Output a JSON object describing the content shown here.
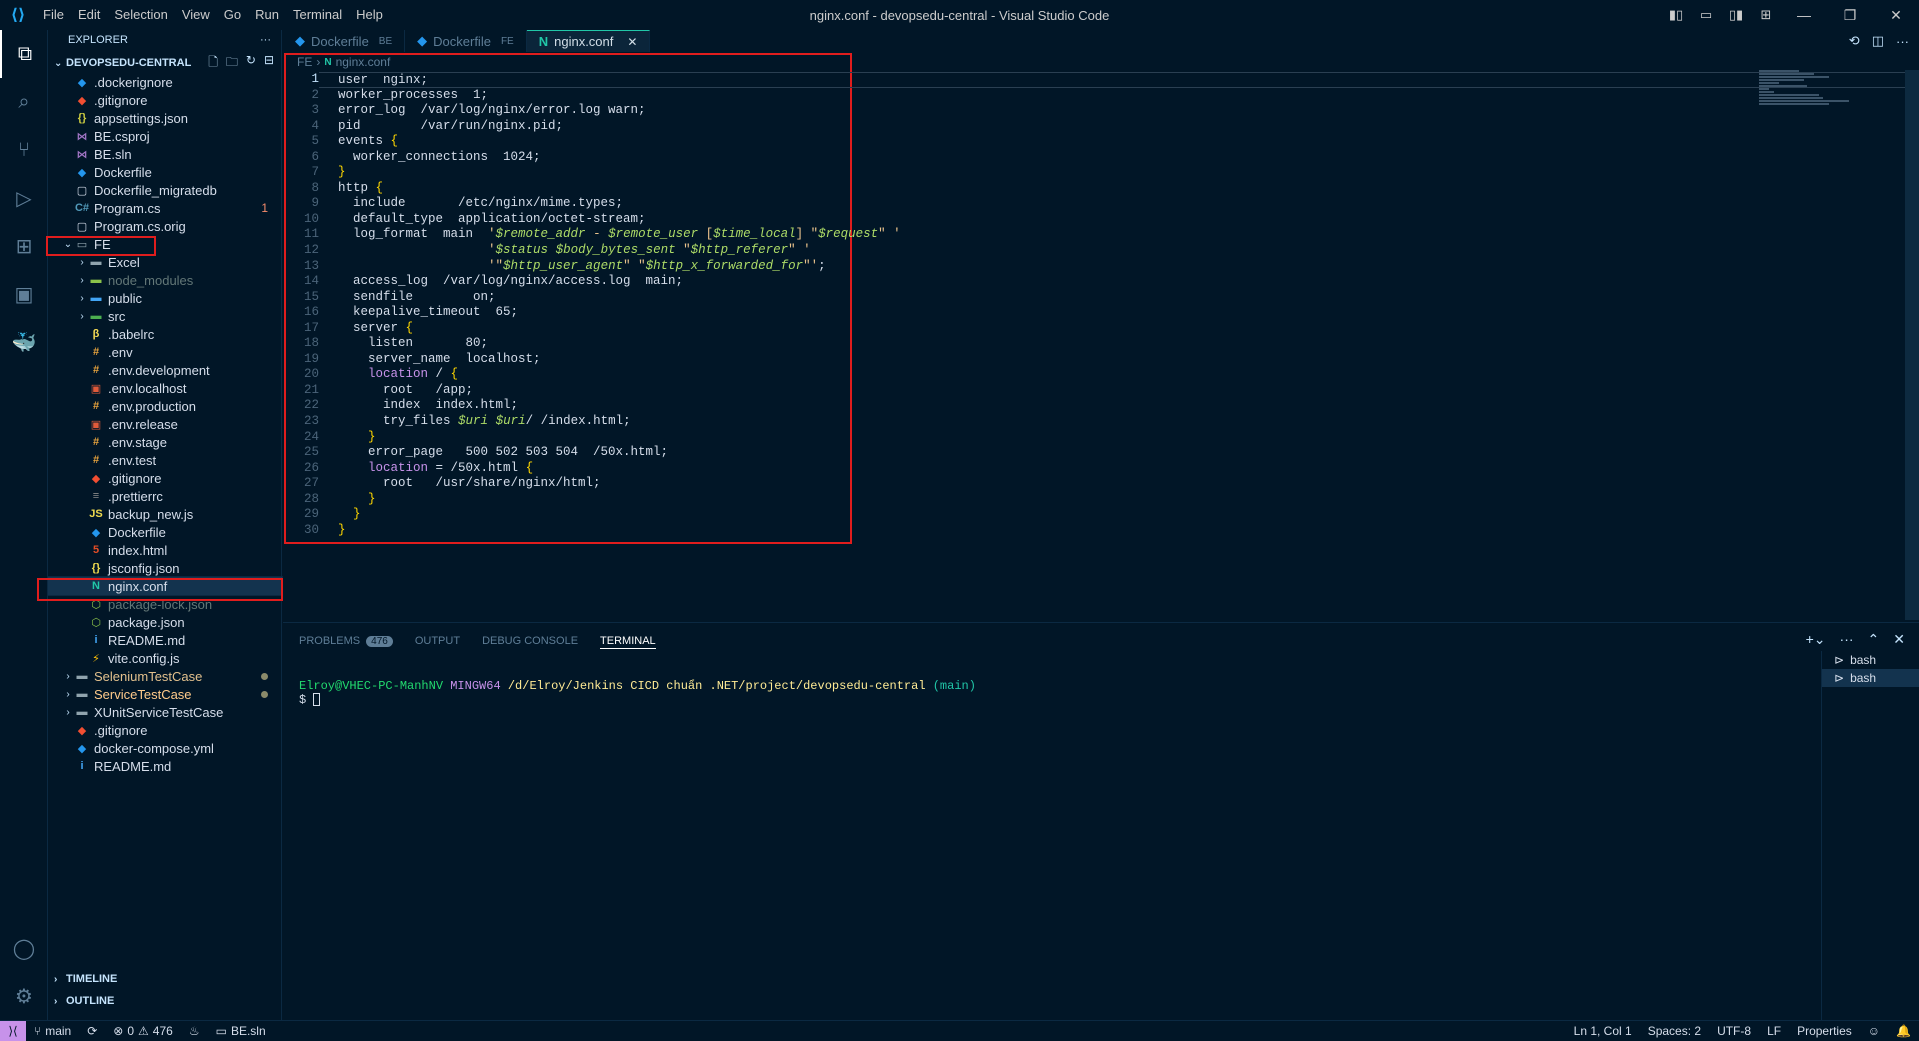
{
  "titlebar": {
    "menu": [
      "File",
      "Edit",
      "Selection",
      "View",
      "Go",
      "Run",
      "Terminal",
      "Help"
    ],
    "title": "nginx.conf - devopsedu-central - Visual Studio Code"
  },
  "sidebar": {
    "header": "EXPLORER",
    "root": "DEVOPSEDU-CENTRAL",
    "items": [
      {
        "label": ".dockerignore",
        "icon": "docker-icon",
        "color": "#2496ed"
      },
      {
        "label": ".gitignore",
        "icon": "git-icon",
        "color": "#f14e32"
      },
      {
        "label": "appsettings.json",
        "icon": "json-icon",
        "color": "#cbcb41"
      },
      {
        "label": "BE.csproj",
        "icon": "visualstudio-icon",
        "color": "#a074c4"
      },
      {
        "label": "BE.sln",
        "icon": "visualstudio-icon",
        "color": "#a074c4"
      },
      {
        "label": "Dockerfile",
        "icon": "docker-icon",
        "color": "#2496ed"
      },
      {
        "label": "Dockerfile_migratedb",
        "icon": "file-icon",
        "color": "#d6deeb"
      },
      {
        "label": "Program.cs",
        "icon": "csharp-icon",
        "color": "#519aba",
        "badge": "1"
      },
      {
        "label": "Program.cs.orig",
        "icon": "file-icon",
        "color": "#d6deeb"
      },
      {
        "label": "FE",
        "icon": "folder-open-icon",
        "folder": true,
        "open": true
      },
      {
        "label": "Excel",
        "icon": "folder-icon",
        "folder": true,
        "indent": 1
      },
      {
        "label": "node_modules",
        "icon": "folder-node-icon",
        "folder": true,
        "indent": 1,
        "dim": true
      },
      {
        "label": "public",
        "icon": "folder-public-icon",
        "folder": true,
        "indent": 1
      },
      {
        "label": "src",
        "icon": "folder-src-icon",
        "folder": true,
        "indent": 1
      },
      {
        "label": ".babelrc",
        "icon": "babel-icon",
        "color": "#f5da55",
        "indent": 1
      },
      {
        "label": ".env",
        "icon": "env-icon",
        "color": "#e8a33d",
        "indent": 1
      },
      {
        "label": ".env.development",
        "icon": "env-icon",
        "color": "#e8a33d",
        "indent": 1
      },
      {
        "label": ".env.localhost",
        "icon": "env-local-icon",
        "color": "#e05a3a",
        "indent": 1
      },
      {
        "label": ".env.production",
        "icon": "env-icon",
        "color": "#e8a33d",
        "indent": 1
      },
      {
        "label": ".env.release",
        "icon": "env-local-icon",
        "color": "#e05a3a",
        "indent": 1
      },
      {
        "label": ".env.stage",
        "icon": "env-icon",
        "color": "#e8a33d",
        "indent": 1
      },
      {
        "label": ".env.test",
        "icon": "env-icon",
        "color": "#e8a33d",
        "indent": 1
      },
      {
        "label": ".gitignore",
        "icon": "git-icon",
        "color": "#f14e32",
        "indent": 1
      },
      {
        "label": ".prettierrc",
        "icon": "prettier-icon",
        "color": "#8a8a8a",
        "indent": 1
      },
      {
        "label": "backup_new.js",
        "icon": "js-icon",
        "color": "#f0db4f",
        "indent": 1
      },
      {
        "label": "Dockerfile",
        "icon": "docker-icon",
        "color": "#2496ed",
        "indent": 1
      },
      {
        "label": "index.html",
        "icon": "html-icon",
        "color": "#e44d26",
        "indent": 1
      },
      {
        "label": "jsconfig.json",
        "icon": "jsconfig-icon",
        "color": "#f0db4f",
        "indent": 1
      },
      {
        "label": "nginx.conf",
        "icon": "nginx-icon",
        "color": "#21c7a8",
        "indent": 1,
        "selected": true
      },
      {
        "label": "package-lock.json",
        "icon": "npm-icon",
        "color": "#8bc34a",
        "indent": 1,
        "dim": true
      },
      {
        "label": "package.json",
        "icon": "npm-icon",
        "color": "#8bc34a",
        "indent": 1
      },
      {
        "label": "README.md",
        "icon": "info-icon",
        "color": "#42a5f5",
        "indent": 1
      },
      {
        "label": "vite.config.js",
        "icon": "vite-icon",
        "color": "#ffc107",
        "indent": 1
      },
      {
        "label": "SeleniumTestCase",
        "icon": "folder-icon",
        "folder": true,
        "yellow": true,
        "dot": true
      },
      {
        "label": "ServiceTestCase",
        "icon": "folder-icon",
        "folder": true,
        "orange": true,
        "dot": true
      },
      {
        "label": "XUnitServiceTestCase",
        "icon": "folder-icon",
        "folder": true
      },
      {
        "label": ".gitignore",
        "icon": "git-icon",
        "color": "#f14e32"
      },
      {
        "label": "docker-compose.yml",
        "icon": "docker-icon",
        "color": "#2496ed"
      },
      {
        "label": "README.md",
        "icon": "info-icon",
        "color": "#42a5f5"
      }
    ],
    "timeline": "TIMELINE",
    "outline": "OUTLINE"
  },
  "tabs": [
    {
      "label": "Dockerfile",
      "desc": "BE",
      "active": false
    },
    {
      "label": "Dockerfile",
      "desc": "FE",
      "active": false
    },
    {
      "label": "nginx.conf",
      "desc": "",
      "active": true
    }
  ],
  "breadcrumb": {
    "folder": "FE",
    "file": "nginx.conf"
  },
  "editor": {
    "lines": [
      "user  nginx;",
      "worker_processes  1;",
      "error_log  /var/log/nginx/error.log warn;",
      "pid        /var/run/nginx.pid;",
      "events {",
      "  worker_connections  1024;",
      "}",
      "http {",
      "  include       /etc/nginx/mime.types;",
      "  default_type  application/octet-stream;",
      "  log_format  main  '$remote_addr - $remote_user [$time_local] \"$request\" '",
      "                    '$status $body_bytes_sent \"$http_referer\" '",
      "                    '\"$http_user_agent\" \"$http_x_forwarded_for\"';",
      "  access_log  /var/log/nginx/access.log  main;",
      "  sendfile        on;",
      "  keepalive_timeout  65;",
      "  server {",
      "    listen       80;",
      "    server_name  localhost;",
      "    location / {",
      "      root   /app;",
      "      index  index.html;",
      "      try_files $uri $uri/ /index.html;",
      "    }",
      "    error_page   500 502 503 504  /50x.html;",
      "    location = /50x.html {",
      "      root   /usr/share/nginx/html;",
      "    }",
      "  }",
      "}"
    ]
  },
  "panel": {
    "tabs": [
      "PROBLEMS",
      "OUTPUT",
      "DEBUG CONSOLE",
      "TERMINAL"
    ],
    "problems_count": "476",
    "terminal": {
      "user": "Elroy@VHEC-PC-ManhNV",
      "host": "MINGW64",
      "path": "/d/Elroy/Jenkins CICD chuẩn .NET/project/devopsedu-central",
      "branch": "(main)",
      "prompt": "$"
    },
    "terminals": [
      "bash",
      "bash"
    ]
  },
  "statusbar": {
    "branch": "main",
    "errors": "0",
    "warnings": "476",
    "solution": "BE.sln",
    "position": "Ln 1, Col 1",
    "spaces": "Spaces: 2",
    "encoding": "UTF-8",
    "eol": "LF",
    "language": "Properties"
  }
}
